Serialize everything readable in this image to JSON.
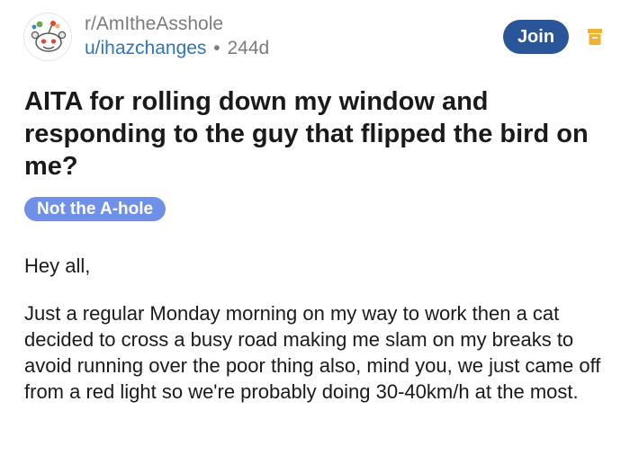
{
  "post_header": {
    "subreddit": "r/AmItheAsshole",
    "username": "u/ihazchanges",
    "separator": "•",
    "age": "244d",
    "join_label": "Join"
  },
  "post": {
    "title": "AITA for rolling down my window and responding to the guy that flipped the bird on me?",
    "flair": "Not the A-hole",
    "paragraphs": [
      "Hey all,",
      "Just a regular Monday morning on my way to work then a cat decided to cross a busy road making me slam on my breaks to avoid running over the poor thing also, mind you, we just came off from a red light so we're probably doing 30-40km/h at the most."
    ]
  },
  "colors": {
    "join_button": "#2a5699",
    "username_link": "#2e76b9",
    "flair_background": "#6f8fe8",
    "archive_icon": "#f1b233"
  },
  "icons": {
    "avatar": "subreddit-avatar-icon",
    "archive": "archive-icon"
  }
}
